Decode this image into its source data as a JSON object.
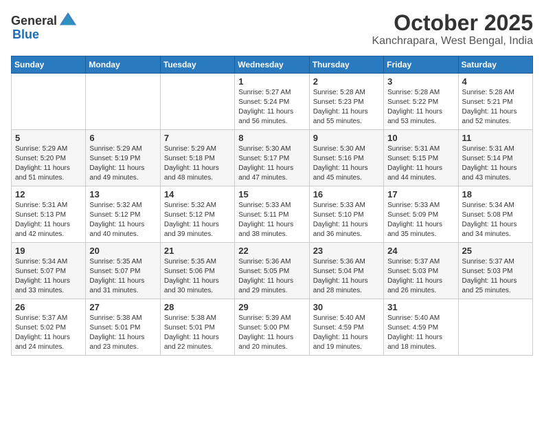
{
  "header": {
    "logo_general": "General",
    "logo_blue": "Blue",
    "month": "October 2025",
    "location": "Kanchrapara, West Bengal, India"
  },
  "weekdays": [
    "Sunday",
    "Monday",
    "Tuesday",
    "Wednesday",
    "Thursday",
    "Friday",
    "Saturday"
  ],
  "weeks": [
    [
      {
        "day": "",
        "sunrise": "",
        "sunset": "",
        "daylight": ""
      },
      {
        "day": "",
        "sunrise": "",
        "sunset": "",
        "daylight": ""
      },
      {
        "day": "",
        "sunrise": "",
        "sunset": "",
        "daylight": ""
      },
      {
        "day": "1",
        "sunrise": "Sunrise: 5:27 AM",
        "sunset": "Sunset: 5:24 PM",
        "daylight": "Daylight: 11 hours and 56 minutes."
      },
      {
        "day": "2",
        "sunrise": "Sunrise: 5:28 AM",
        "sunset": "Sunset: 5:23 PM",
        "daylight": "Daylight: 11 hours and 55 minutes."
      },
      {
        "day": "3",
        "sunrise": "Sunrise: 5:28 AM",
        "sunset": "Sunset: 5:22 PM",
        "daylight": "Daylight: 11 hours and 53 minutes."
      },
      {
        "day": "4",
        "sunrise": "Sunrise: 5:28 AM",
        "sunset": "Sunset: 5:21 PM",
        "daylight": "Daylight: 11 hours and 52 minutes."
      }
    ],
    [
      {
        "day": "5",
        "sunrise": "Sunrise: 5:29 AM",
        "sunset": "Sunset: 5:20 PM",
        "daylight": "Daylight: 11 hours and 51 minutes."
      },
      {
        "day": "6",
        "sunrise": "Sunrise: 5:29 AM",
        "sunset": "Sunset: 5:19 PM",
        "daylight": "Daylight: 11 hours and 49 minutes."
      },
      {
        "day": "7",
        "sunrise": "Sunrise: 5:29 AM",
        "sunset": "Sunset: 5:18 PM",
        "daylight": "Daylight: 11 hours and 48 minutes."
      },
      {
        "day": "8",
        "sunrise": "Sunrise: 5:30 AM",
        "sunset": "Sunset: 5:17 PM",
        "daylight": "Daylight: 11 hours and 47 minutes."
      },
      {
        "day": "9",
        "sunrise": "Sunrise: 5:30 AM",
        "sunset": "Sunset: 5:16 PM",
        "daylight": "Daylight: 11 hours and 45 minutes."
      },
      {
        "day": "10",
        "sunrise": "Sunrise: 5:31 AM",
        "sunset": "Sunset: 5:15 PM",
        "daylight": "Daylight: 11 hours and 44 minutes."
      },
      {
        "day": "11",
        "sunrise": "Sunrise: 5:31 AM",
        "sunset": "Sunset: 5:14 PM",
        "daylight": "Daylight: 11 hours and 43 minutes."
      }
    ],
    [
      {
        "day": "12",
        "sunrise": "Sunrise: 5:31 AM",
        "sunset": "Sunset: 5:13 PM",
        "daylight": "Daylight: 11 hours and 42 minutes."
      },
      {
        "day": "13",
        "sunrise": "Sunrise: 5:32 AM",
        "sunset": "Sunset: 5:12 PM",
        "daylight": "Daylight: 11 hours and 40 minutes."
      },
      {
        "day": "14",
        "sunrise": "Sunrise: 5:32 AM",
        "sunset": "Sunset: 5:12 PM",
        "daylight": "Daylight: 11 hours and 39 minutes."
      },
      {
        "day": "15",
        "sunrise": "Sunrise: 5:33 AM",
        "sunset": "Sunset: 5:11 PM",
        "daylight": "Daylight: 11 hours and 38 minutes."
      },
      {
        "day": "16",
        "sunrise": "Sunrise: 5:33 AM",
        "sunset": "Sunset: 5:10 PM",
        "daylight": "Daylight: 11 hours and 36 minutes."
      },
      {
        "day": "17",
        "sunrise": "Sunrise: 5:33 AM",
        "sunset": "Sunset: 5:09 PM",
        "daylight": "Daylight: 11 hours and 35 minutes."
      },
      {
        "day": "18",
        "sunrise": "Sunrise: 5:34 AM",
        "sunset": "Sunset: 5:08 PM",
        "daylight": "Daylight: 11 hours and 34 minutes."
      }
    ],
    [
      {
        "day": "19",
        "sunrise": "Sunrise: 5:34 AM",
        "sunset": "Sunset: 5:07 PM",
        "daylight": "Daylight: 11 hours and 33 minutes."
      },
      {
        "day": "20",
        "sunrise": "Sunrise: 5:35 AM",
        "sunset": "Sunset: 5:07 PM",
        "daylight": "Daylight: 11 hours and 31 minutes."
      },
      {
        "day": "21",
        "sunrise": "Sunrise: 5:35 AM",
        "sunset": "Sunset: 5:06 PM",
        "daylight": "Daylight: 11 hours and 30 minutes."
      },
      {
        "day": "22",
        "sunrise": "Sunrise: 5:36 AM",
        "sunset": "Sunset: 5:05 PM",
        "daylight": "Daylight: 11 hours and 29 minutes."
      },
      {
        "day": "23",
        "sunrise": "Sunrise: 5:36 AM",
        "sunset": "Sunset: 5:04 PM",
        "daylight": "Daylight: 11 hours and 28 minutes."
      },
      {
        "day": "24",
        "sunrise": "Sunrise: 5:37 AM",
        "sunset": "Sunset: 5:03 PM",
        "daylight": "Daylight: 11 hours and 26 minutes."
      },
      {
        "day": "25",
        "sunrise": "Sunrise: 5:37 AM",
        "sunset": "Sunset: 5:03 PM",
        "daylight": "Daylight: 11 hours and 25 minutes."
      }
    ],
    [
      {
        "day": "26",
        "sunrise": "Sunrise: 5:37 AM",
        "sunset": "Sunset: 5:02 PM",
        "daylight": "Daylight: 11 hours and 24 minutes."
      },
      {
        "day": "27",
        "sunrise": "Sunrise: 5:38 AM",
        "sunset": "Sunset: 5:01 PM",
        "daylight": "Daylight: 11 hours and 23 minutes."
      },
      {
        "day": "28",
        "sunrise": "Sunrise: 5:38 AM",
        "sunset": "Sunset: 5:01 PM",
        "daylight": "Daylight: 11 hours and 22 minutes."
      },
      {
        "day": "29",
        "sunrise": "Sunrise: 5:39 AM",
        "sunset": "Sunset: 5:00 PM",
        "daylight": "Daylight: 11 hours and 20 minutes."
      },
      {
        "day": "30",
        "sunrise": "Sunrise: 5:40 AM",
        "sunset": "Sunset: 4:59 PM",
        "daylight": "Daylight: 11 hours and 19 minutes."
      },
      {
        "day": "31",
        "sunrise": "Sunrise: 5:40 AM",
        "sunset": "Sunset: 4:59 PM",
        "daylight": "Daylight: 11 hours and 18 minutes."
      },
      {
        "day": "",
        "sunrise": "",
        "sunset": "",
        "daylight": ""
      }
    ]
  ]
}
